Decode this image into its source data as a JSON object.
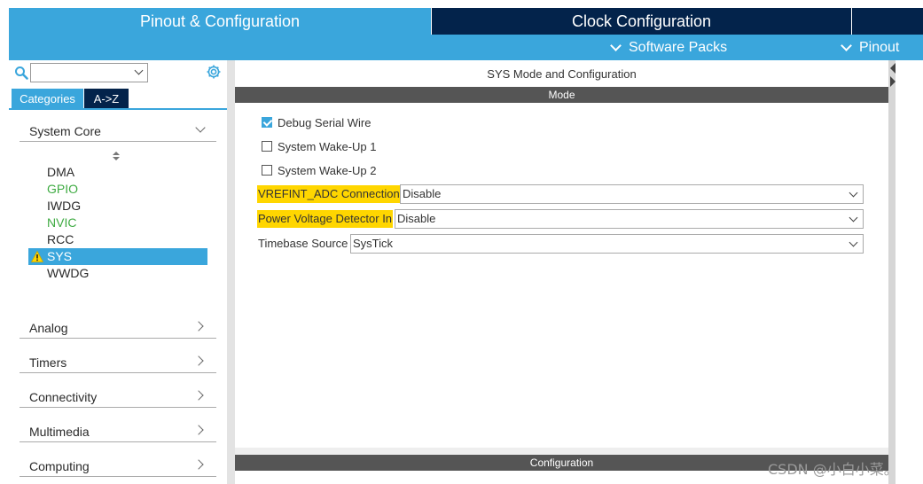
{
  "top_tabs": {
    "pinout_config": "Pinout & Configuration",
    "clock_config": "Clock Configuration"
  },
  "sub_menu": {
    "software_packs": "Software Packs",
    "pinout": "Pinout"
  },
  "left_panel": {
    "search_value": "",
    "tabs": {
      "categories": "Categories",
      "az": "A->Z"
    },
    "system_core": "System Core",
    "peripherals": [
      {
        "name": "DMA",
        "status": "normal"
      },
      {
        "name": "GPIO",
        "status": "configured"
      },
      {
        "name": "IWDG",
        "status": "normal"
      },
      {
        "name": "NVIC",
        "status": "configured"
      },
      {
        "name": "RCC",
        "status": "normal"
      },
      {
        "name": "SYS",
        "status": "warning-selected"
      },
      {
        "name": "WWDG",
        "status": "normal"
      }
    ],
    "categories": [
      "Analog",
      "Timers",
      "Connectivity",
      "Multimedia",
      "Computing"
    ]
  },
  "right_panel": {
    "title": "SYS Mode and Configuration",
    "mode_header": "Mode",
    "checkboxes": [
      {
        "label": "Debug Serial Wire",
        "checked": true
      },
      {
        "label": "System Wake-Up 1",
        "checked": false
      },
      {
        "label": "System Wake-Up 2",
        "checked": false
      }
    ],
    "fields": [
      {
        "label": "VREFINT_ADC Connection",
        "value": "Disable",
        "highlighted": true
      },
      {
        "label": "Power Voltage Detector In",
        "value": "Disable",
        "highlighted": true
      },
      {
        "label": "Timebase Source",
        "value": "SysTick",
        "highlighted": false
      }
    ],
    "config_header": "Configuration"
  },
  "colors": {
    "accent_blue": "#3aa6dc",
    "dark_navy": "#03234b",
    "highlight_yellow": "#ffd600",
    "configured_green": "#3fab43"
  },
  "watermark": "CSDN @小白小菜。"
}
